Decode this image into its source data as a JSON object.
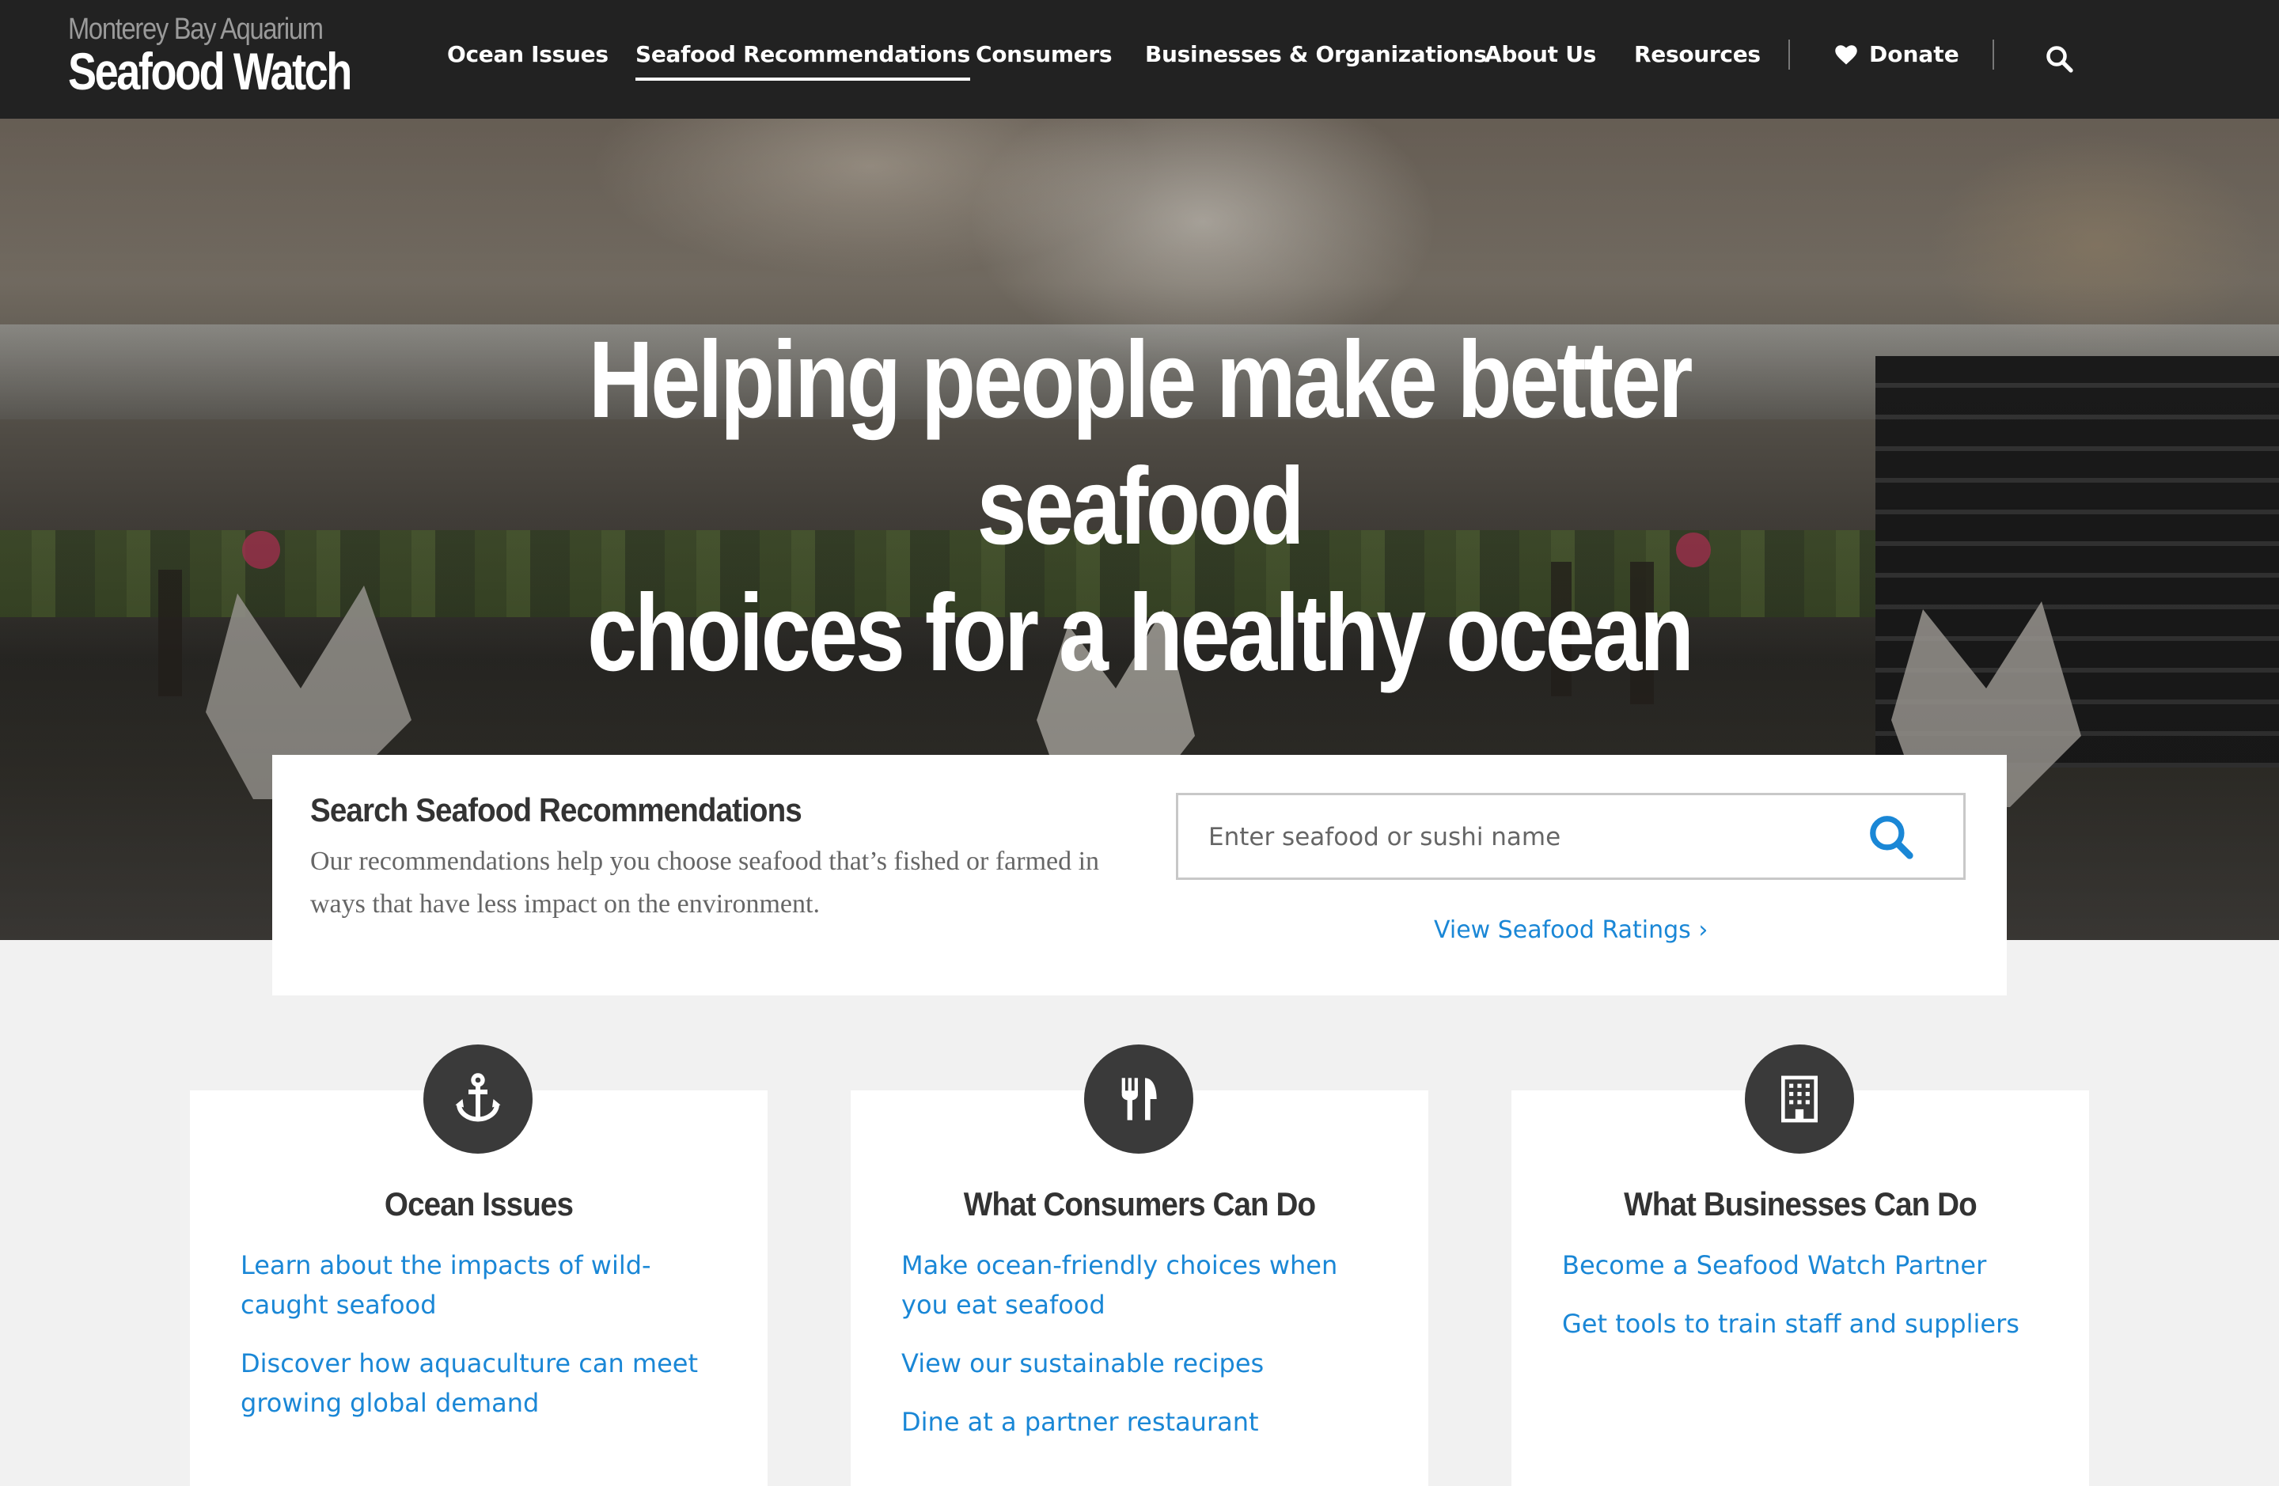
{
  "header": {
    "logo_top": "Monterey Bay Aquarium",
    "logo_main": "Seafood Watch",
    "nav": [
      {
        "label": "Ocean Issues",
        "active": false
      },
      {
        "label": "Seafood Recommendations",
        "active": true
      },
      {
        "label": "Consumers",
        "active": false
      },
      {
        "label": "Businesses & Organizations",
        "active": false
      },
      {
        "label": "About Us",
        "active": false
      },
      {
        "label": "Resources",
        "active": false
      }
    ],
    "donate_label": "Donate",
    "search_icon": "search-icon"
  },
  "hero": {
    "title_line1": "Helping people make better seafood",
    "title_line2": "choices for a healthy ocean"
  },
  "search": {
    "title": "Search Seafood Recommendations",
    "description": "Our recommendations help you choose seafood that’s fished or farmed in ways that have less impact on the environment.",
    "placeholder": "Enter seafood or sushi name",
    "value": "",
    "link_label": "View Seafood Ratings ›"
  },
  "cards": [
    {
      "icon": "anchor-icon",
      "title": "Ocean Issues",
      "links": [
        "Learn about the impacts of wild-caught seafood",
        "Discover how aquaculture can meet growing global demand"
      ]
    },
    {
      "icon": "fork-knife-icon",
      "title": "What Consumers Can Do",
      "links": [
        "Make ocean-friendly choices when you eat seafood",
        "View our sustainable recipes",
        "Dine at a partner restaurant"
      ]
    },
    {
      "icon": "building-icon",
      "title": "What Businesses Can Do",
      "links": [
        "Become a Seafood Watch Partner",
        "Get tools to train staff and suppliers"
      ]
    }
  ],
  "colors": {
    "nav_bg": "#222222",
    "link_blue": "#1a87d6",
    "icon_circle": "#3a3a3a",
    "page_bg": "#f1f1f1"
  }
}
